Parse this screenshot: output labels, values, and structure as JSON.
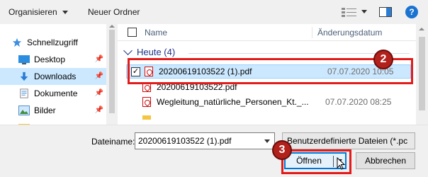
{
  "toolbar": {
    "organize_label": "Organisieren",
    "new_folder_label": "Neuer Ordner",
    "help_label": "?"
  },
  "nav": {
    "items": [
      {
        "label": "Schnellzugriff",
        "icon": "star-icon"
      },
      {
        "label": "Desktop",
        "icon": "desktop-folder-icon",
        "pinned": true
      },
      {
        "label": "Downloads",
        "icon": "downloads-folder-icon",
        "pinned": true,
        "selected": true
      },
      {
        "label": "Dokumente",
        "icon": "documents-folder-icon",
        "pinned": true
      },
      {
        "label": "Bilder",
        "icon": "pictures-folder-icon",
        "pinned": true
      }
    ]
  },
  "list": {
    "col_name": "Name",
    "col_date": "Änderungsdatum",
    "group_label": "Heute (4)",
    "rows": [
      {
        "name": "20200619103522 (1).pdf",
        "date": "07.07.2020 10:05",
        "selected": true,
        "checked": "✓"
      },
      {
        "name": "20200619103522.pdf",
        "date": ""
      },
      {
        "name": "Wegleitung_natürliche_Personen_Kt._...",
        "date": "07.07.2020 08:25"
      }
    ]
  },
  "bottom": {
    "filename_label": "Dateiname:",
    "filename_value": "20200619103522 (1).pdf",
    "filetype_value": "Benutzerdefinierte Dateien (*.pc",
    "open_label": "Öffnen",
    "cancel_label": "Abbrechen"
  },
  "annotations": {
    "step_row": "2",
    "step_button": "3",
    "color": "#e31b1b"
  }
}
